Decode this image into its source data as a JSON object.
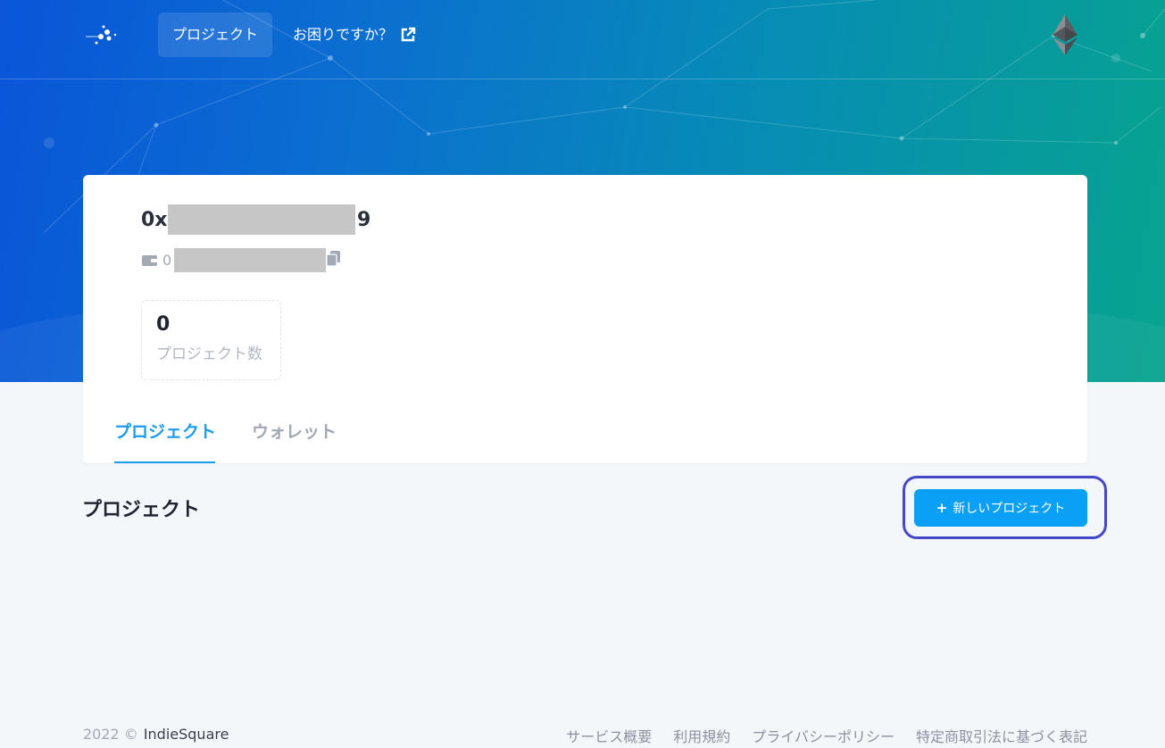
{
  "header": {
    "nav_projects": "プロジェクト",
    "nav_help": "お困りですか？",
    "help_icon": "external-link-icon",
    "network_icon": "ethereum-icon",
    "logo_icon": "dots-logo-icon"
  },
  "account": {
    "title_prefix": "0x",
    "title_suffix": "9",
    "address_prefix": "0",
    "wallet_icon": "wallet-icon",
    "copy_icon": "copy-icon"
  },
  "stats": {
    "projects_count": "0",
    "projects_label": "プロジェクト数"
  },
  "tabs": [
    {
      "label": "プロジェクト",
      "active": true
    },
    {
      "label": "ウォレット",
      "active": false
    }
  ],
  "section": {
    "title": "プロジェクト",
    "new_project_label": "新しいプロジェクト",
    "new_project_plus": "+"
  },
  "footer": {
    "copyright": "2022 ©",
    "brand": "IndieSquare",
    "links": [
      "サービス概要",
      "利用規約",
      "プライバシーポリシー",
      "特定商取引法に基づく表記"
    ]
  },
  "colors": {
    "accent": "#0aa0f5",
    "tab_active": "#1a9bee",
    "highlight_outline": "#4448c8"
  }
}
